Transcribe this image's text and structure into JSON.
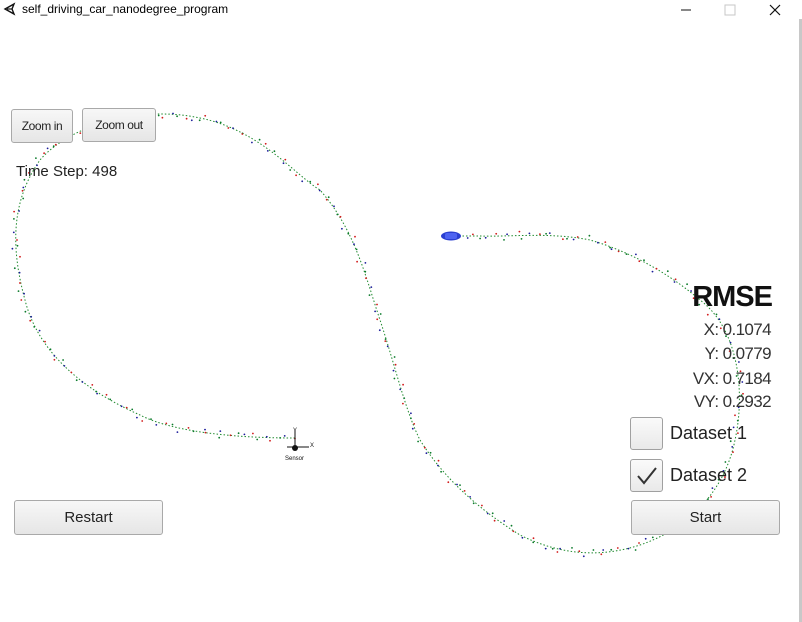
{
  "window": {
    "title": "self_driving_car_nanodegree_program"
  },
  "controls": {
    "zoom_in_label": "Zoom in",
    "zoom_out_label": "Zoom out",
    "restart_label": "Restart",
    "start_label": "Start"
  },
  "status": {
    "time_step_text": "Time Step: 498"
  },
  "rmse": {
    "title": "RMSE",
    "x_text": "X: 0.1074",
    "y_text": "Y: 0.0779",
    "vx_text": "VX: 0.7184",
    "vy_text": "VY: 0.2932"
  },
  "datasets": [
    {
      "label": "Dataset 1",
      "checked": false
    },
    {
      "label": "Dataset 2",
      "checked": true
    }
  ],
  "scene": {
    "sensor_label": "Sensor",
    "axis_x_label": "X",
    "axis_y_label": "Y",
    "colors": {
      "ground_truth": "#1f8a2e",
      "lidar_marker": "#d21a1a",
      "radar_marker": "#1b1b9a",
      "estimate_marker": "#0a7a2a",
      "car": "#2a3fd1"
    },
    "icons": [
      "unity-logo-icon",
      "minimize-icon",
      "maximize-icon",
      "close-icon",
      "checkmark-icon",
      "car-icon"
    ]
  }
}
